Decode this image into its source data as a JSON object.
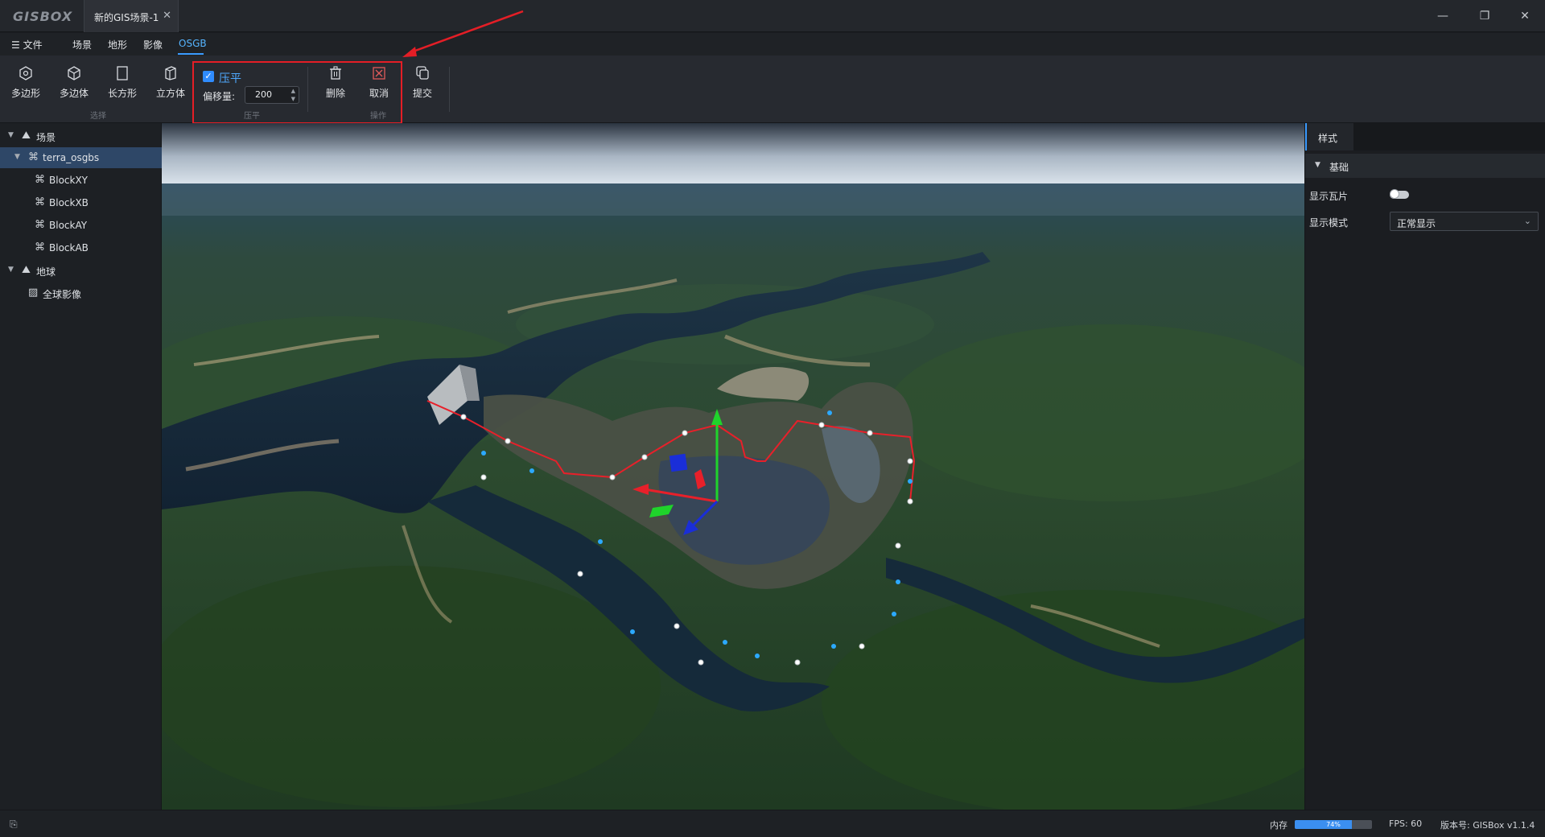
{
  "app": {
    "logo": "GISBOX",
    "document_tab": "新的GIS场景-1",
    "close_tab": "✕",
    "window_controls": {
      "minimize": "—",
      "restore": "❐",
      "close": "✕"
    }
  },
  "menu": {
    "file": "文件",
    "tabs": [
      "场景",
      "地形",
      "影像",
      "OSGB"
    ],
    "active_tab": "OSGB"
  },
  "ribbon": {
    "select_tools": [
      {
        "label": "多边形",
        "icon": "hexagon-icon"
      },
      {
        "label": "多边体",
        "icon": "polyhedron-icon"
      },
      {
        "label": "长方形",
        "icon": "rectangle-icon"
      },
      {
        "label": "立方体",
        "icon": "cube-icon"
      }
    ],
    "select_group_label": "选择",
    "flatten": {
      "checkbox_label": "压平",
      "checked": true,
      "offset_label": "偏移量:",
      "offset_value": "200",
      "group_label": "压平"
    },
    "operations": [
      {
        "label": "删除",
        "icon": "trash-icon"
      },
      {
        "label": "取消",
        "icon": "cancel-box-icon"
      }
    ],
    "operations_group_label": "操作",
    "submit_label": "提交",
    "highlight_color": "#e41e26"
  },
  "tree": {
    "nodes": [
      {
        "label": "场景",
        "icon": "scene-icon",
        "level": 0,
        "expanded": true
      },
      {
        "label": "terra_osgbs",
        "icon": "model-icon",
        "level": 1,
        "expanded": true,
        "selected": true
      },
      {
        "label": "BlockXY",
        "icon": "model-icon",
        "level": 2
      },
      {
        "label": "BlockXB",
        "icon": "model-icon",
        "level": 2
      },
      {
        "label": "BlockAY",
        "icon": "model-icon",
        "level": 2
      },
      {
        "label": "BlockAB",
        "icon": "model-icon",
        "level": 2
      },
      {
        "label": "地球",
        "icon": "globe-icon",
        "level": 0,
        "expanded": true
      },
      {
        "label": "全球影像",
        "icon": "imagery-icon",
        "level": 1
      }
    ]
  },
  "properties": {
    "tab": "样式",
    "section": "基础",
    "show_tiles_label": "显示瓦片",
    "show_tiles_on": false,
    "display_mode_label": "显示模式",
    "display_mode_value": "正常显示"
  },
  "status": {
    "memory_label": "内存",
    "memory_percent": 74,
    "memory_text": "74%",
    "fps": "FPS: 60",
    "version": "版本号: GISBox v1.1.4"
  },
  "colors": {
    "accent": "#3a9bff",
    "selection": "#2e4767",
    "polygon_line": "#e8202a"
  }
}
